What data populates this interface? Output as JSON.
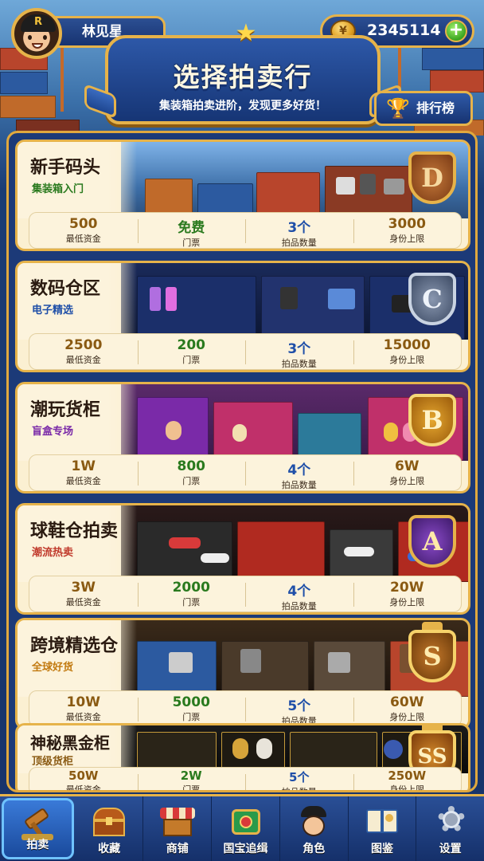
{
  "player": {
    "name": "林见星",
    "avatar_letter": "R"
  },
  "currency": {
    "amount": "2345114",
    "icon": "coin-stack-icon",
    "add_icon": "plus-icon"
  },
  "header": {
    "title": "选择拍卖行",
    "subtitle": "集装箱拍卖进阶，发现更多好货！",
    "rank_button": "排行榜",
    "rank_icon": "trophy-icon"
  },
  "stat_labels": [
    "最低资金",
    "门票",
    "拍品数量",
    "身份上限"
  ],
  "houses": [
    {
      "name": "新手码头",
      "tag": "集装箱入门",
      "tag_color": "#2a7a1e",
      "grade": "D",
      "min_funds": "500",
      "ticket": "免费",
      "items": "3个",
      "identity_cap": "3000"
    },
    {
      "name": "数码仓区",
      "tag": "电子精选",
      "tag_color": "#1f4fa8",
      "grade": "C",
      "min_funds": "2500",
      "ticket": "200",
      "items": "3个",
      "identity_cap": "15000"
    },
    {
      "name": "潮玩货柜",
      "tag": "盲盒专场",
      "tag_color": "#7a2aa8",
      "grade": "B",
      "min_funds": "1W",
      "ticket": "800",
      "items": "4个",
      "identity_cap": "6W"
    },
    {
      "name": "球鞋仓拍卖",
      "tag": "潮流热卖",
      "tag_color": "#c0392b",
      "grade": "A",
      "min_funds": "3W",
      "ticket": "2000",
      "items": "4个",
      "identity_cap": "20W"
    },
    {
      "name": "跨境精选仓",
      "tag": "全球好货",
      "tag_color": "#c27a10",
      "grade": "S",
      "min_funds": "10W",
      "ticket": "5000",
      "items": "5个",
      "identity_cap": "60W"
    },
    {
      "name": "神秘黑金柜",
      "tag": "顶级货柜",
      "tag_color": "#8a5a12",
      "grade": "SS",
      "min_funds": "50W",
      "ticket": "2W",
      "items": "5个",
      "identity_cap": "250W"
    }
  ],
  "nav": [
    {
      "label": "拍卖",
      "icon": "gavel-icon",
      "active": true
    },
    {
      "label": "收藏",
      "icon": "treasure-chest-icon"
    },
    {
      "label": "商铺",
      "icon": "shop-icon"
    },
    {
      "label": "国宝追缉",
      "icon": "scroll-map-icon"
    },
    {
      "label": "角色",
      "icon": "character-icon"
    },
    {
      "label": "图鉴",
      "icon": "book-icon"
    },
    {
      "label": "设置",
      "icon": "gear-icon"
    }
  ]
}
